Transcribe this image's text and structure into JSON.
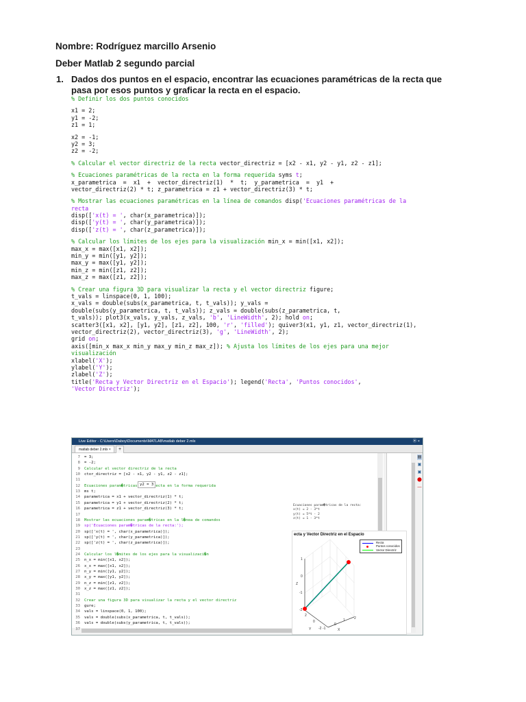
{
  "header": {
    "name": "Nombre: Rodríguez marcillo Arsenio",
    "subject": "Deber Matlab 2 segundo parcial"
  },
  "question": {
    "number": "1.",
    "text": "Dados dos puntos en el espacio, encontrar las ecuaciones paramétricas de la recta que pasa por esos puntos y graficar la recta en el espacio."
  },
  "code": [
    [
      [
        "c",
        "% Definir los dos puntos conocidos"
      ]
    ],
    null,
    [
      [
        "k",
        "x1 = 2;"
      ]
    ],
    [
      [
        "k",
        "y1 = -2;"
      ]
    ],
    [
      [
        "k",
        "z1 = 1;"
      ]
    ],
    null,
    [
      [
        "k",
        "x2 = -1;"
      ]
    ],
    [
      [
        "k",
        "y2 = 3;"
      ]
    ],
    [
      [
        "k",
        "z2 = -2;"
      ]
    ],
    null,
    [
      [
        "c",
        "% Calcular el vector directriz de la recta "
      ],
      [
        "k",
        "vector_directriz = [x2 - x1, y2 - y1, z2 - z1];"
      ]
    ],
    null,
    [
      [
        "c",
        "% Ecuaciones paramétricas de la recta en la forma requerida "
      ],
      [
        "k",
        "syms "
      ],
      [
        "s",
        "t"
      ],
      [
        "k",
        ";"
      ]
    ],
    [
      [
        "k",
        "x_parametrica  =  x1  +  vector_directriz(1)  *  t;  y_parametrica  =  y1  +"
      ]
    ],
    [
      [
        "k",
        "vector_directriz(2) * t; z_parametrica = z1 + vector_directriz(3) * t;"
      ]
    ],
    null,
    [
      [
        "c",
        "% Mostrar las ecuaciones paramétricas en la línea de comandos "
      ],
      [
        "k",
        "disp("
      ],
      [
        "s",
        "'Ecuaciones paramétricas de la"
      ]
    ],
    [
      [
        "s",
        "recta"
      ]
    ],
    [
      [
        "k",
        "disp(["
      ],
      [
        "s",
        "'x(t) = '"
      ],
      [
        "k",
        ", char(x_parametrica)]);"
      ]
    ],
    [
      [
        "k",
        "disp(["
      ],
      [
        "s",
        "'y(t) = '"
      ],
      [
        "k",
        ", char(y_parametrica)]);"
      ]
    ],
    [
      [
        "k",
        "disp(["
      ],
      [
        "s",
        "'z(t) = '"
      ],
      [
        "k",
        ", char(z_parametrica)]);"
      ]
    ],
    null,
    [
      [
        "c",
        "% Calcular los límites de los ejes para la visualización "
      ],
      [
        "k",
        "min_x = min([x1, x2]);"
      ]
    ],
    [
      [
        "k",
        "max_x = max([x1, x2]);"
      ]
    ],
    [
      [
        "k",
        "min_y = min([y1, y2]);"
      ]
    ],
    [
      [
        "k",
        "max_y = max([y1, y2]);"
      ]
    ],
    [
      [
        "k",
        "min_z = min([z1, z2]);"
      ]
    ],
    [
      [
        "k",
        "max_z = max([z1, z2]);"
      ]
    ],
    null,
    [
      [
        "c",
        "% Crear una figura 3D para visualizar la recta y el vector directriz "
      ],
      [
        "k",
        "figure;"
      ]
    ],
    [
      [
        "k",
        "t_vals = linspace(0, 1, 100);"
      ]
    ],
    [
      [
        "k",
        "x_vals = double(subs(x_parametrica, t, t_vals)); y_vals ="
      ]
    ],
    [
      [
        "k",
        "double(subs(y_parametrica, t, t_vals)); z_vals = double(subs(z_parametrica, t,"
      ]
    ],
    [
      [
        "k",
        "t_vals)); plot3(x_vals, y_vals, z_vals, "
      ],
      [
        "s",
        "'b'"
      ],
      [
        "k",
        ", "
      ],
      [
        "s",
        "'LineWidth'"
      ],
      [
        "k",
        ", 2); hold "
      ],
      [
        "s",
        "on"
      ],
      [
        "k",
        ";"
      ]
    ],
    [
      [
        "k",
        "scatter3([x1, x2], [y1, y2], [z1, z2], 100, "
      ],
      [
        "s",
        "'r'"
      ],
      [
        "k",
        ", "
      ],
      [
        "s",
        "'filled'"
      ],
      [
        "k",
        "); quiver3(x1, y1, z1, vector_directriz(1),"
      ]
    ],
    [
      [
        "k",
        "vector_directriz(2), vector_directriz(3), "
      ],
      [
        "s",
        "'g'"
      ],
      [
        "k",
        ", "
      ],
      [
        "s",
        "'LineWidth'"
      ],
      [
        "k",
        ", 2);"
      ]
    ],
    [
      [
        "k",
        "grid "
      ],
      [
        "s",
        "on"
      ],
      [
        "k",
        ";"
      ]
    ],
    [
      [
        "k",
        "axis([min_x max_x min_y max_y min_z max_z]); "
      ],
      [
        "c",
        "% Ajusta los límites de los ejes para una mejor"
      ]
    ],
    [
      [
        "c",
        "visualización"
      ]
    ],
    [
      [
        "k",
        "xlabel("
      ],
      [
        "s",
        "'X'"
      ],
      [
        "k",
        ");"
      ]
    ],
    [
      [
        "k",
        "ylabel("
      ],
      [
        "s",
        "'Y'"
      ],
      [
        "k",
        ");"
      ]
    ],
    [
      [
        "k",
        "zlabel("
      ],
      [
        "s",
        "'Z'"
      ],
      [
        "k",
        ");"
      ]
    ],
    [
      [
        "k",
        "title("
      ],
      [
        "s",
        "'Recta y Vector Directriz en el Espacio'"
      ],
      [
        "k",
        "); legend("
      ],
      [
        "s",
        "'Recta'"
      ],
      [
        "k",
        ", "
      ],
      [
        "s",
        "'Puntos conocidos'"
      ],
      [
        "k",
        ","
      ]
    ],
    [
      [
        "s",
        "'Vector Directriz'"
      ],
      [
        "k",
        ");"
      ]
    ]
  ],
  "screenshot": {
    "window_title": "Live Editor - C:\\Users\\Daboy\\Documents\\MATLAB\\matlab deber 2.mlx",
    "window_controls": "⦿ ×",
    "tab_label": "matlab deber 2.mlx  ×",
    "tab_add": "+",
    "editor_lines": [
      [
        "7",
        "= 3;",
        "k"
      ],
      [
        "8",
        "= -2;",
        "k"
      ],
      [
        "9",
        "Calcular el vector directriz de la recta",
        "c"
      ],
      [
        "10",
        "ctor_directriz = [x2 - x1, y2 - y1, z2 - z1];",
        "k"
      ],
      [
        "11",
        "",
        "k"
      ],
      [
        "12",
        "Ecuaciones param�tricas de la recta en la forma requerida",
        "c"
      ],
      [
        "13",
        "ms t;",
        "k"
      ],
      [
        "14",
        "parametrica = x1 + vector_directriz(1) * t;",
        "k"
      ],
      [
        "15",
        "parametrica = y1 + vector_directriz(2) * t;",
        "k"
      ],
      [
        "16",
        "parametrica = z1 + vector_directriz(3) * t;",
        "k"
      ],
      [
        "17",
        "",
        "k"
      ],
      [
        "18",
        "Mostrar las ecuaciones param�tricas en la l�nea de comandos",
        "c"
      ],
      [
        "19",
        "sp('Ecuaciones param�tricas de la recta:');",
        "s"
      ],
      [
        "20",
        "sp(['x(t) = ', char(x_parametrica)]);",
        "k"
      ],
      [
        "21",
        "sp(['y(t) = ', char(y_parametrica)]);",
        "k"
      ],
      [
        "22",
        "sp(['z(t) = ', char(z_parametrica)]);",
        "k"
      ],
      [
        "23",
        "",
        "k"
      ],
      [
        "24",
        "Calcular los l�mites de los ejes para la visualizaci�n",
        "c"
      ],
      [
        "25",
        "n_x = min([x1, x2]);",
        "k"
      ],
      [
        "26",
        "x_x = max([x1, x2]);",
        "k"
      ],
      [
        "27",
        "n_y = min([y1, y2]);",
        "k"
      ],
      [
        "28",
        "x_y = max([y1, y2]);",
        "k"
      ],
      [
        "29",
        "n_z = min([z1, z2]);",
        "k"
      ],
      [
        "30",
        "x_z = max([z1, z2]);",
        "k"
      ],
      [
        "31",
        "",
        "k"
      ],
      [
        "32",
        "Crear una figura 3D para visualizar la recta y el vector directriz",
        "c"
      ],
      [
        "33",
        "gure;",
        "k"
      ],
      [
        "34",
        "vals = linspace(0, 1, 100);",
        "k"
      ],
      [
        "35",
        "vals = double(subs(x_parametrica, t, t_vals));",
        "k"
      ],
      [
        "36",
        "vals = double(subs(y_parametrica, t, t_vals));",
        "k"
      ],
      [
        "37",
        "",
        "k"
      ]
    ],
    "tooltip": "y2 = 3",
    "output": [
      "Ecuaciones param�tricas de la recta:",
      "x(t) = 2 - 3*t",
      "y(t) = 5*t - 2",
      "z(t) = 1 - 3*t"
    ],
    "plot": {
      "title": "ecta y Vector Directriz en el Espacio",
      "legend": [
        "Recta",
        "Puntos conocidos",
        "Vector Directriz"
      ],
      "zticks": [
        "1",
        "0",
        "-1",
        "-2"
      ],
      "yticks": [
        "2",
        "0",
        "-2"
      ],
      "xticks": [
        "-1",
        "0",
        "1",
        "2"
      ],
      "xlabel": "X",
      "ylabel": "Y",
      "zlabel": "Z"
    },
    "colors": {
      "line": "#0000ff",
      "points": "#ff0000",
      "vector": "#00ff00",
      "titlebar": "#18406e"
    }
  },
  "chart_data": {
    "type": "line",
    "title": "Recta y Vector Directriz en el Espacio",
    "series": [
      {
        "name": "Recta",
        "points": [
          [
            2,
            -2,
            1
          ],
          [
            -1,
            3,
            -2
          ]
        ]
      },
      {
        "name": "Puntos conocidos",
        "points": [
          [
            2,
            -2,
            1
          ],
          [
            -1,
            3,
            -2
          ]
        ]
      },
      {
        "name": "Vector Directriz",
        "origin": [
          2,
          -2,
          1
        ],
        "vector": [
          -3,
          5,
          -3
        ]
      }
    ],
    "xlabel": "X",
    "ylabel": "Y",
    "zlabel": "Z",
    "xlim": [
      -1,
      2
    ],
    "ylim": [
      -2,
      3
    ],
    "zlim": [
      -2,
      1
    ],
    "grid": true,
    "legend": "top-right"
  }
}
